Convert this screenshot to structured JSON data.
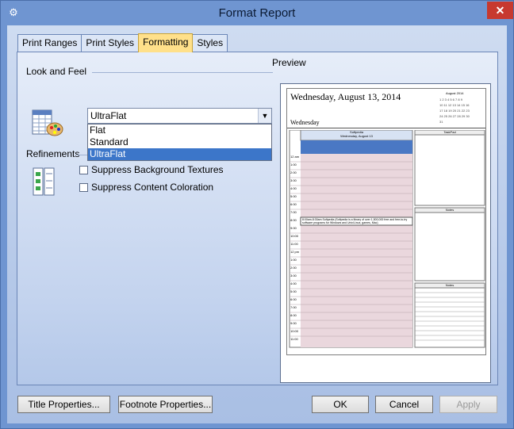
{
  "window": {
    "title": "Format Report",
    "close_glyph": "✕",
    "app_icon": "gear-icon"
  },
  "tabs": [
    {
      "label": "Print Ranges"
    },
    {
      "label": "Print Styles"
    },
    {
      "label": "Formatting",
      "active": true
    },
    {
      "label": "Styles"
    }
  ],
  "look_and_feel": {
    "label": "Look and Feel",
    "selected": "UltraFlat",
    "options": [
      "Flat",
      "Standard",
      "UltraFlat"
    ]
  },
  "refinements": {
    "label": "Refinements",
    "suppress_background": "Suppress Background Textures",
    "suppress_content": "Suppress Content Coloration"
  },
  "preview": {
    "label": "Preview",
    "date_title": "Wednesday, August 13, 2014",
    "day_label": "Wednesday",
    "resource": "Softpedia",
    "resource_date": "Wednesday, August 13",
    "tasklist": "TaskPad",
    "notes1": "Notes",
    "notes2": "Notes",
    "mini_cal_title": "August 2014",
    "times": [
      "12 am",
      "1:00",
      "2:00",
      "3:00",
      "4:00",
      "5:00",
      "6:00",
      "7:00",
      "8:00",
      "9:00",
      "10:00",
      "11:00",
      "12 pm",
      "1:00",
      "2:00",
      "3:00",
      "4:00",
      "5:00",
      "6:00",
      "7:00",
      "8:00",
      "9:00",
      "10:00",
      "11:00"
    ],
    "event_text": "8:00am-8:30am Softpedia (Softpedia is a library of over 1,500,000 free and free-to-try software programs for Windows and Unix/Linux, games, Mac)"
  },
  "buttons": {
    "title_props": "Title Properties...",
    "footnote_props": "Footnote Properties...",
    "ok": "OK",
    "cancel": "Cancel",
    "apply": "Apply"
  }
}
